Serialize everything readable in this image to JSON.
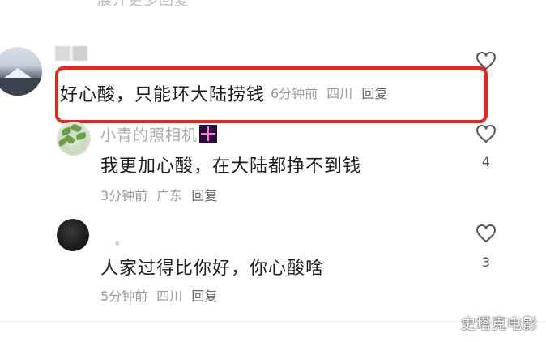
{
  "top_partial_text": "展开更多回复",
  "comments": [
    {
      "username": "",
      "text": "好心酸，只能环大陆捞钱",
      "time": "6分钟前",
      "location": "四川",
      "reply_label": "回复",
      "likes": ""
    },
    {
      "username": "小青的照相机",
      "text": "我更加心酸，在大陆都挣不到钱",
      "time": "3分钟前",
      "location": "广东",
      "reply_label": "回复",
      "likes": "4"
    },
    {
      "username": "。",
      "text": "人家过得比你好，你心酸啥",
      "time": "5分钟前",
      "location": "四川",
      "reply_label": "回复",
      "likes": "3"
    }
  ],
  "watermark": "史塔克电影",
  "colors": {
    "highlight": "#e8261c",
    "meta": "#9a9a9a",
    "text": "#1c1c1c"
  },
  "icons": {
    "like": "heart-outline-icon",
    "emoji": "sparkle-emoji-icon"
  }
}
